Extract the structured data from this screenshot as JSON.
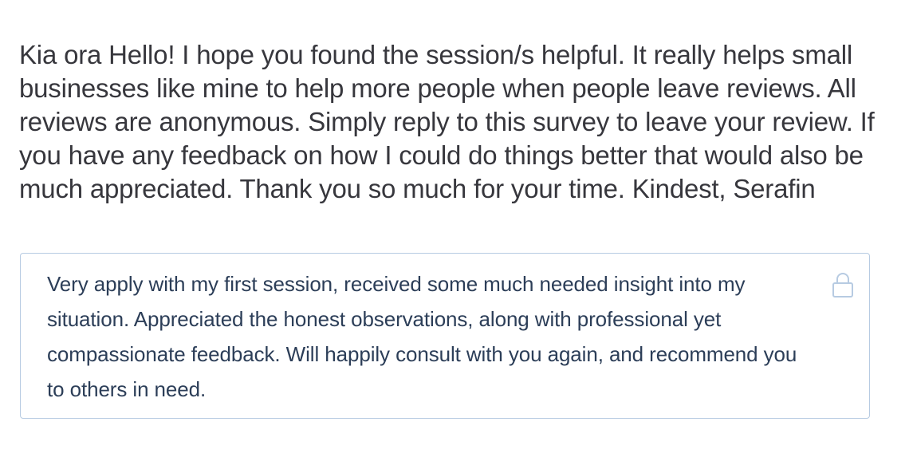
{
  "question": {
    "text": "Kia ora Hello! I hope you found the session/s helpful. It really helps small businesses like mine to help more people when people leave reviews. All reviews are anonymous. Simply reply to this survey to leave your review. If you have any feedback on how I could do things better that would also be much appreciated. Thank you so much for your time. Kindest, Serafin"
  },
  "response": {
    "text": "Very apply with my first session, received some much needed insight into my situation. Appreciated the honest observations, along with professional yet compassionate feedback. Will happily consult with you again, and recommend you to others in need.",
    "locked_icon": "lock-icon"
  },
  "colors": {
    "question_text": "#37373d",
    "response_text": "#2c3e58",
    "box_border": "#b7cbe2",
    "icon": "#b7cbe2"
  }
}
